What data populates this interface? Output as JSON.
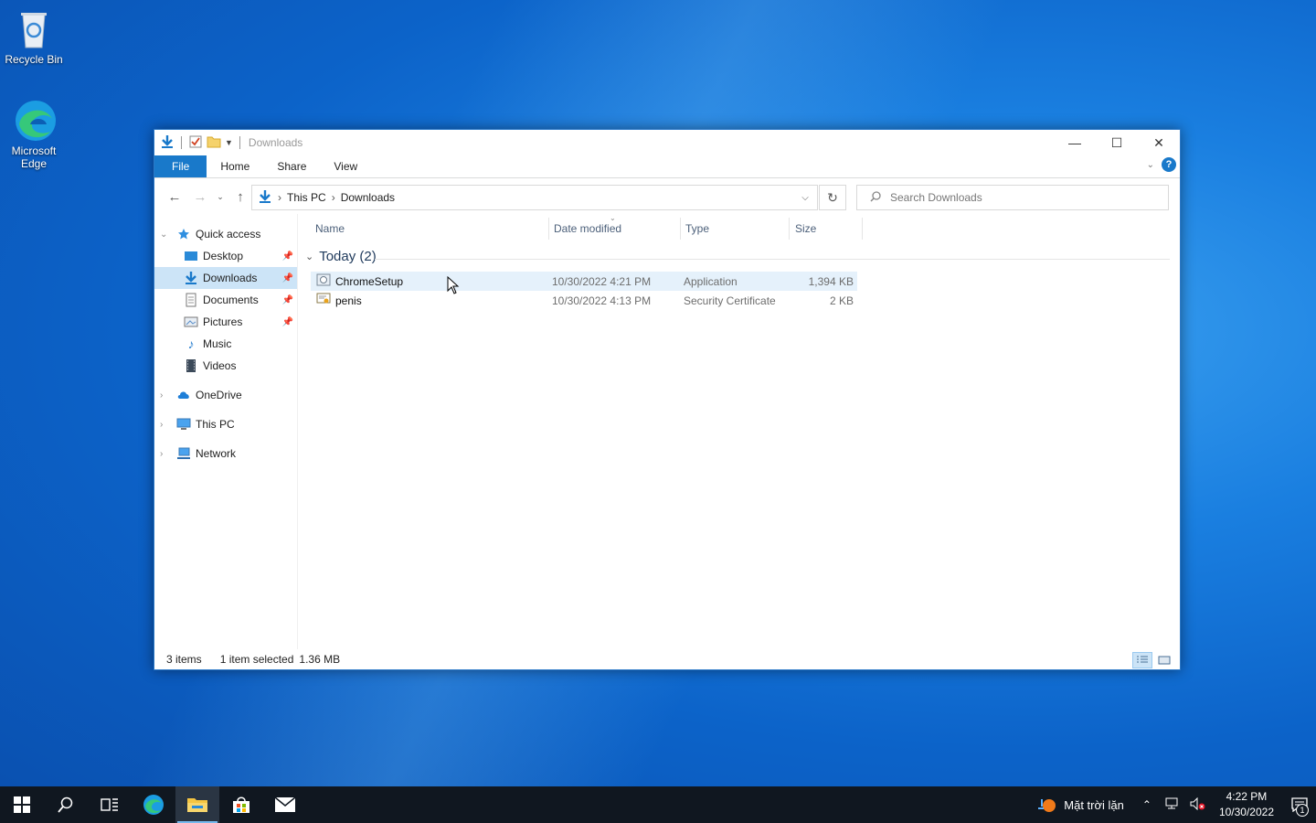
{
  "desktop": {
    "icons": [
      {
        "label": "Recycle Bin",
        "icon": "recycle-bin-icon"
      },
      {
        "label": "Microsoft Edge",
        "icon": "edge-icon"
      }
    ]
  },
  "window": {
    "title": "Downloads",
    "ribbon_tabs": [
      "File",
      "Home",
      "Share",
      "View"
    ],
    "help_label": "?",
    "address": {
      "crumbs": [
        "This PC",
        "Downloads"
      ]
    },
    "search": {
      "placeholder": "Search Downloads"
    },
    "nav": {
      "quick_access": "Quick access",
      "items": [
        {
          "label": "Desktop",
          "pinned": true,
          "icon": "desktop-folder-icon"
        },
        {
          "label": "Downloads",
          "pinned": true,
          "icon": "downloads-folder-icon",
          "selected": true
        },
        {
          "label": "Documents",
          "pinned": true,
          "icon": "documents-folder-icon"
        },
        {
          "label": "Pictures",
          "pinned": true,
          "icon": "pictures-folder-icon"
        },
        {
          "label": "Music",
          "pinned": false,
          "icon": "music-folder-icon"
        },
        {
          "label": "Videos",
          "pinned": false,
          "icon": "videos-folder-icon"
        }
      ],
      "onedrive": "OneDrive",
      "this_pc": "This PC",
      "network": "Network"
    },
    "columns": [
      "Name",
      "Date modified",
      "Type",
      "Size"
    ],
    "group": "Today (2)",
    "files": [
      {
        "name": "ChromeSetup",
        "date": "10/30/2022 4:21 PM",
        "type": "Application",
        "size": "1,394 KB",
        "selected": true,
        "icon": "application-icon"
      },
      {
        "name": "penis",
        "date": "10/30/2022 4:13 PM",
        "type": "Security Certificate",
        "size": "2 KB",
        "selected": false,
        "icon": "certificate-icon"
      }
    ],
    "status": {
      "items": "3 items",
      "selected": "1 item selected",
      "size": "1.36 MB"
    }
  },
  "taskbar": {
    "weather": "Mặt trời lặn",
    "time": "4:22 PM",
    "date": "10/30/2022",
    "notification_count": "1"
  },
  "colors": {
    "accent": "#1979ca",
    "selection": "#cce4f7",
    "taskbar": "#101720"
  }
}
